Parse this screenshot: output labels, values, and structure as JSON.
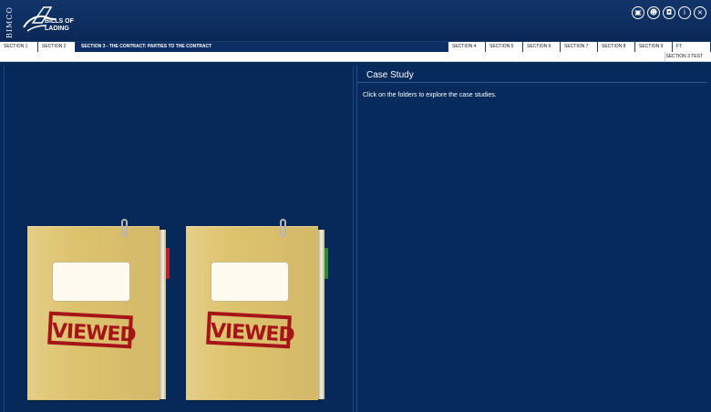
{
  "header": {
    "brand_vertical": "BIMCO",
    "title_line1": "BILLS OF",
    "title_line2": "LADING"
  },
  "header_icons": [
    {
      "name": "glossary-icon",
      "glyph": "▣"
    },
    {
      "name": "people-icon",
      "glyph": "☻"
    },
    {
      "name": "certificate-icon",
      "glyph": "◘"
    },
    {
      "name": "info-icon",
      "glyph": "i"
    },
    {
      "name": "close-icon",
      "glyph": "×"
    }
  ],
  "tabs": [
    {
      "label": "SECTION 1"
    },
    {
      "label": "SECTION 2"
    },
    {
      "label": "SECTION 3 - THE CONTRACT: PARTIES TO THE CONTRACT",
      "active": true
    },
    {
      "label": "SECTION 4"
    },
    {
      "label": "SECTION 5"
    },
    {
      "label": "SECTION 6"
    },
    {
      "label": "SECTION 7"
    },
    {
      "label": "SECTION 8"
    },
    {
      "label": "SECTION 9"
    },
    {
      "label": "FT"
    }
  ],
  "subbar": {
    "section_test": "SECTION 3 TEST"
  },
  "left": {
    "folders": [
      {
        "stamp": "VIEWED",
        "tab_color": "#b51e2a"
      },
      {
        "stamp": "VIEWED",
        "tab_color": "#2d8b35"
      }
    ]
  },
  "right": {
    "title": "Case Study",
    "instructions": "Click on the folders to explore the case studies."
  }
}
